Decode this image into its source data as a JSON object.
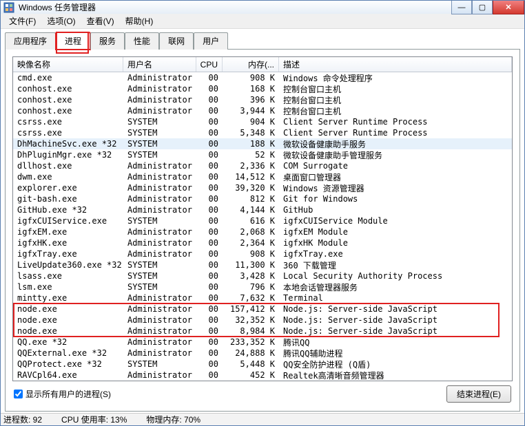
{
  "window": {
    "title": "Windows 任务管理器"
  },
  "menu": [
    "文件(F)",
    "选项(O)",
    "查看(V)",
    "帮助(H)"
  ],
  "tabs": [
    "应用程序",
    "进程",
    "服务",
    "性能",
    "联网",
    "用户"
  ],
  "active_tab": 1,
  "columns": {
    "name": "映像名称",
    "user": "用户名",
    "cpu": "CPU",
    "mem": "内存(...",
    "desc": "描述"
  },
  "processes": [
    {
      "name": "cmd.exe",
      "user": "Administrator",
      "cpu": "00",
      "mem": "908 K",
      "desc": "Windows 命令处理程序",
      "sel": false
    },
    {
      "name": "conhost.exe",
      "user": "Administrator",
      "cpu": "00",
      "mem": "168 K",
      "desc": "控制台窗口主机",
      "sel": false
    },
    {
      "name": "conhost.exe",
      "user": "Administrator",
      "cpu": "00",
      "mem": "396 K",
      "desc": "控制台窗口主机",
      "sel": false
    },
    {
      "name": "conhost.exe",
      "user": "Administrator",
      "cpu": "00",
      "mem": "3,944 K",
      "desc": "控制台窗口主机",
      "sel": false
    },
    {
      "name": "csrss.exe",
      "user": "SYSTEM",
      "cpu": "00",
      "mem": "904 K",
      "desc": "Client Server Runtime Process",
      "sel": false
    },
    {
      "name": "csrss.exe",
      "user": "SYSTEM",
      "cpu": "00",
      "mem": "5,348 K",
      "desc": "Client Server Runtime Process",
      "sel": false
    },
    {
      "name": "DhMachineSvc.exe *32",
      "user": "SYSTEM",
      "cpu": "00",
      "mem": "188 K",
      "desc": "微软设备健康助手服务",
      "sel": true
    },
    {
      "name": "DhPluginMgr.exe *32",
      "user": "SYSTEM",
      "cpu": "00",
      "mem": "52 K",
      "desc": "微软设备健康助手管理服务",
      "sel": false
    },
    {
      "name": "dllhost.exe",
      "user": "Administrator",
      "cpu": "00",
      "mem": "2,336 K",
      "desc": "COM Surrogate",
      "sel": false
    },
    {
      "name": "dwm.exe",
      "user": "Administrator",
      "cpu": "00",
      "mem": "14,512 K",
      "desc": "桌面窗口管理器",
      "sel": false
    },
    {
      "name": "explorer.exe",
      "user": "Administrator",
      "cpu": "00",
      "mem": "39,320 K",
      "desc": "Windows 资源管理器",
      "sel": false
    },
    {
      "name": "git-bash.exe",
      "user": "Administrator",
      "cpu": "00",
      "mem": "812 K",
      "desc": "Git for Windows",
      "sel": false
    },
    {
      "name": "GitHub.exe *32",
      "user": "Administrator",
      "cpu": "00",
      "mem": "4,144 K",
      "desc": "GitHub",
      "sel": false
    },
    {
      "name": "igfxCUIService.exe",
      "user": "SYSTEM",
      "cpu": "00",
      "mem": "616 K",
      "desc": "igfxCUIService Module",
      "sel": false
    },
    {
      "name": "igfxEM.exe",
      "user": "Administrator",
      "cpu": "00",
      "mem": "2,068 K",
      "desc": "igfxEM Module",
      "sel": false
    },
    {
      "name": "igfxHK.exe",
      "user": "Administrator",
      "cpu": "00",
      "mem": "2,364 K",
      "desc": "igfxHK Module",
      "sel": false
    },
    {
      "name": "igfxTray.exe",
      "user": "Administrator",
      "cpu": "00",
      "mem": "908 K",
      "desc": "igfxTray.exe",
      "sel": false
    },
    {
      "name": "LiveUpdate360.exe *32",
      "user": "SYSTEM",
      "cpu": "00",
      "mem": "11,300 K",
      "desc": "360 下载管理",
      "sel": false
    },
    {
      "name": "lsass.exe",
      "user": "SYSTEM",
      "cpu": "00",
      "mem": "3,428 K",
      "desc": "Local Security Authority Process",
      "sel": false
    },
    {
      "name": "lsm.exe",
      "user": "SYSTEM",
      "cpu": "00",
      "mem": "796 K",
      "desc": "本地会话管理器服务",
      "sel": false
    },
    {
      "name": "mintty.exe",
      "user": "Administrator",
      "cpu": "00",
      "mem": "7,632 K",
      "desc": "Terminal",
      "sel": false
    },
    {
      "name": "node.exe",
      "user": "Administrator",
      "cpu": "00",
      "mem": "157,412 K",
      "desc": "Node.js: Server-side JavaScript",
      "sel": false
    },
    {
      "name": "node.exe",
      "user": "Administrator",
      "cpu": "00",
      "mem": "32,352 K",
      "desc": "Node.js: Server-side JavaScript",
      "sel": false
    },
    {
      "name": "node.exe",
      "user": "Administrator",
      "cpu": "00",
      "mem": "8,984 K",
      "desc": "Node.js: Server-side JavaScript",
      "sel": false
    },
    {
      "name": "QQ.exe *32",
      "user": "Administrator",
      "cpu": "00",
      "mem": "233,352 K",
      "desc": "腾讯QQ",
      "sel": false
    },
    {
      "name": "QQExternal.exe *32",
      "user": "Administrator",
      "cpu": "00",
      "mem": "24,888 K",
      "desc": "腾讯QQ辅助进程",
      "sel": false
    },
    {
      "name": "QQProtect.exe *32",
      "user": "SYSTEM",
      "cpu": "00",
      "mem": "5,448 K",
      "desc": "QQ安全防护进程 (Q盾)",
      "sel": false
    },
    {
      "name": "RAVCpl64.exe",
      "user": "Administrator",
      "cpu": "00",
      "mem": "452 K",
      "desc": "Realtek高清晰音频管理器",
      "sel": false
    }
  ],
  "show_all_users": {
    "label": "显示所有用户的进程(S)",
    "checked": true
  },
  "end_process_btn": "结束进程(E)",
  "status": {
    "processes": "进程数: 92",
    "cpu": "CPU 使用率: 13%",
    "mem": "物理内存: 70%"
  }
}
